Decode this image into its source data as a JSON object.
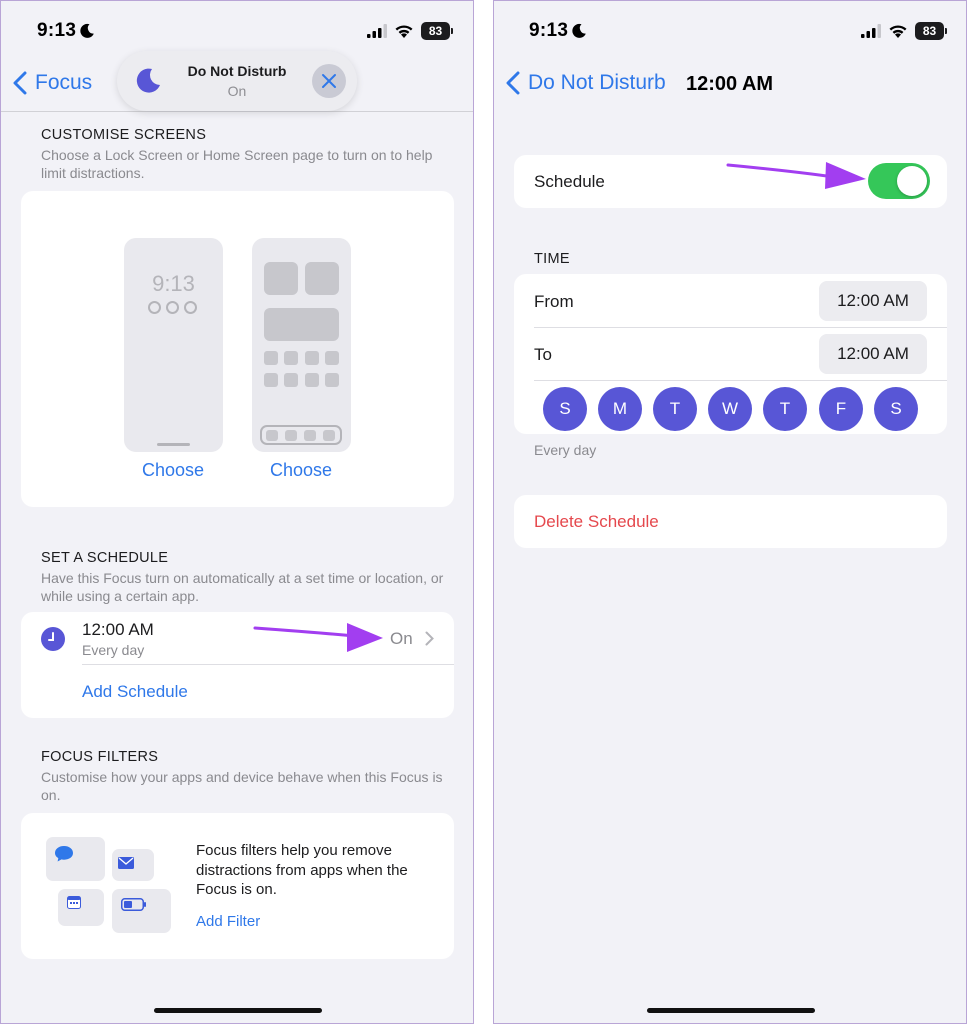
{
  "colors": {
    "accent": "#2f78e9",
    "focus_purple": "#5856d6",
    "toggle_on": "#35c759",
    "destructive": "#e5484d",
    "annotation_arrow": "#a23ef0"
  },
  "left_screen": {
    "status_bar": {
      "time": "9:13",
      "battery": "83"
    },
    "nav": {
      "back_label": "Focus"
    },
    "focus_pill": {
      "title": "Do Not Disturb",
      "status": "On",
      "icon": "moon-icon",
      "close_icon": "close-icon"
    },
    "customise_screens": {
      "header": "CUSTOMISE SCREENS",
      "description": "Choose a Lock Screen or Home Screen page to turn on to help limit distractions.",
      "lock_preview_time": "9:13",
      "lock_choose_label": "Choose",
      "home_choose_label": "Choose"
    },
    "schedule": {
      "header": "SET A SCHEDULE",
      "description": "Have this Focus turn on automatically at a set time or location, or while using a certain app.",
      "item": {
        "time": "12:00 AM",
        "repeat": "Every day",
        "status": "On",
        "icon": "clock-icon"
      },
      "add_label": "Add Schedule"
    },
    "filters": {
      "header": "FOCUS FILTERS",
      "description": "Customise how your apps and device behave when this Focus is on.",
      "body": "Focus filters help you remove distractions from apps when the Focus is on.",
      "add_label": "Add Filter",
      "icons": [
        "message-icon",
        "mail-icon",
        "calendar-icon",
        "battery-icon"
      ]
    }
  },
  "right_screen": {
    "status_bar": {
      "time": "9:13",
      "battery": "83"
    },
    "nav": {
      "back_label": "Do Not Disturb",
      "title": "12:00 AM"
    },
    "schedule_toggle": {
      "label": "Schedule",
      "on": true
    },
    "time": {
      "header": "TIME",
      "from_label": "From",
      "from_value": "12:00 AM",
      "to_label": "To",
      "to_value": "12:00 AM",
      "days": [
        "S",
        "M",
        "T",
        "W",
        "T",
        "F",
        "S"
      ],
      "footer": "Every day"
    },
    "delete_label": "Delete Schedule"
  }
}
